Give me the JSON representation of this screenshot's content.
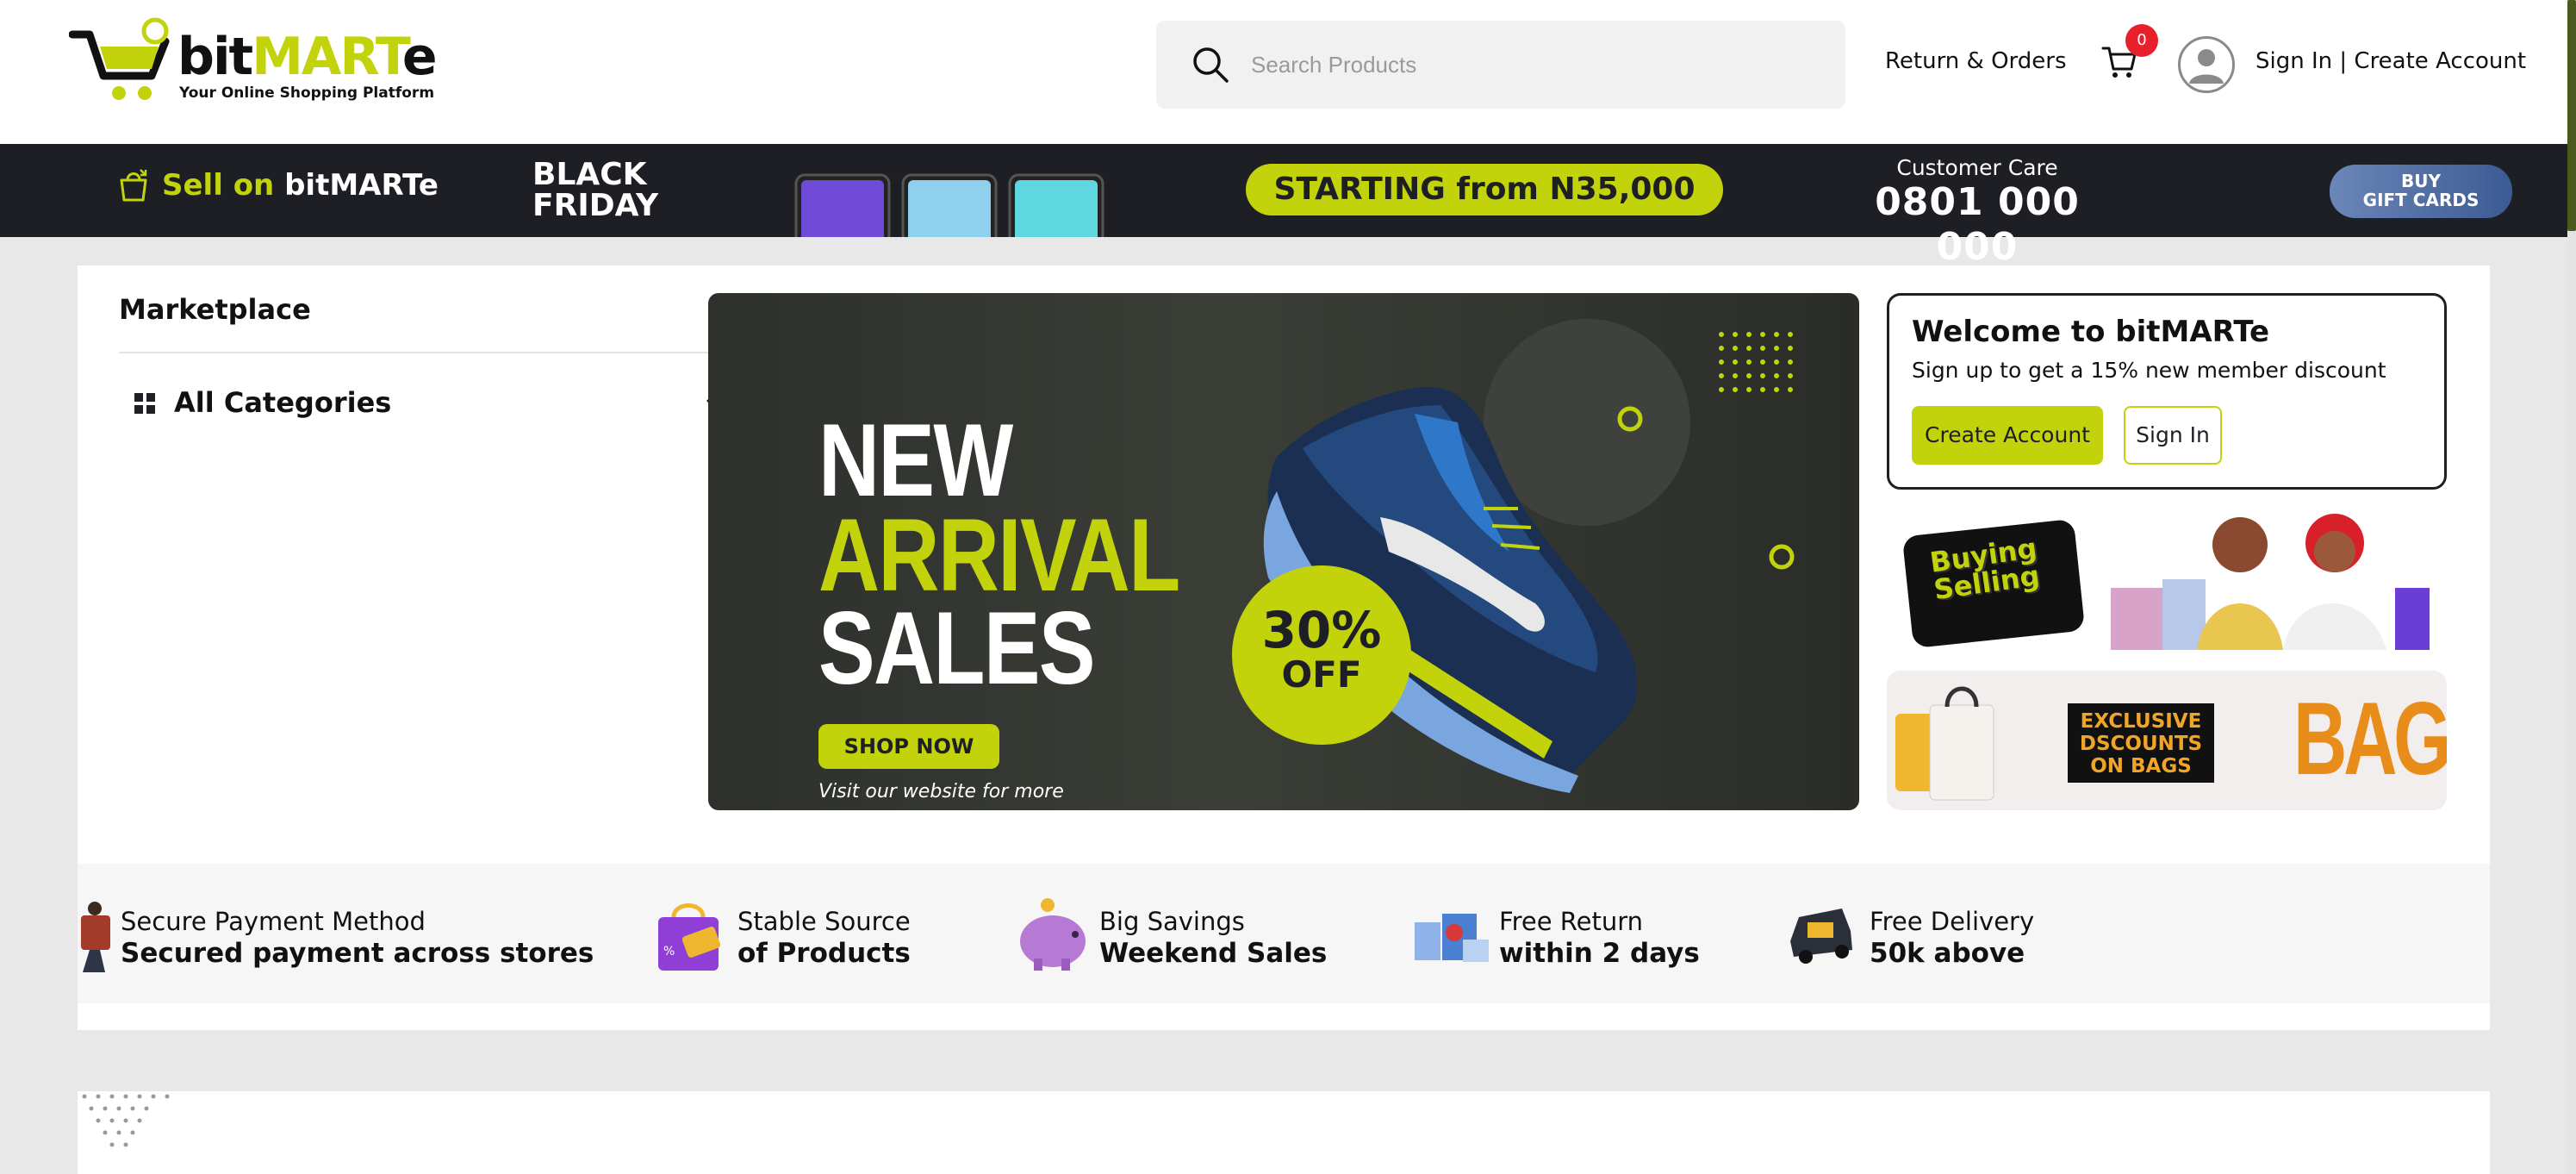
{
  "header": {
    "logo": {
      "name_part1": "bit",
      "name_part2": "MART",
      "name_part3": "e",
      "tagline": "Your Online Shopping Platform"
    },
    "search": {
      "placeholder": "Search Products",
      "value": ""
    },
    "return_orders": "Return & Orders",
    "cart_count": "0",
    "signin_label": "Sign In | Create Account"
  },
  "promo_strip": {
    "sell_prefix": "Sell on ",
    "sell_brand": "bitMARTe",
    "black_friday": [
      "BLACK",
      "FRIDAY"
    ],
    "starting": "STARTING from N35,000",
    "care_label": "Customer Care",
    "care_number": "0801 000 000",
    "gift_cards": [
      "BUY",
      "GIFT CARDS"
    ]
  },
  "marketplace": {
    "title": "Marketplace",
    "all_categories": "All Categories"
  },
  "hero": {
    "line1": "NEW",
    "line2": "ARRIVAL",
    "line3": "SALES",
    "discount_pct": "30%",
    "discount_word": "OFF",
    "cta": "SHOP NOW",
    "footer": "Visit our website for more"
  },
  "welcome": {
    "title": "Welcome to bitMARTe",
    "subtitle": "Sign up to get a 15% new member discount",
    "create_account": "Create Account",
    "sign_in": "Sign In"
  },
  "side_banners": {
    "buying_selling": [
      "Buying",
      "Selling"
    ],
    "exclusive": [
      "EXCLUSIVE",
      "DSCOUNTS",
      "ON BAGS"
    ],
    "bags": "BAGS"
  },
  "features": [
    {
      "icon": "secure-payment-icon",
      "line1": "Secure Payment Method",
      "line2": "Secured payment across stores"
    },
    {
      "icon": "stable-source-icon",
      "line1": "Stable Source",
      "line2": "of Products"
    },
    {
      "icon": "piggy-bank-icon",
      "line1": "Big Savings",
      "line2": "Weekend Sales"
    },
    {
      "icon": "free-return-icon",
      "line1": "Free Return",
      "line2": "within 2 days"
    },
    {
      "icon": "delivery-truck-icon",
      "line1": "Free Delivery",
      "line2": "50k above"
    }
  ],
  "colors": {
    "accent": "#c2d30b",
    "dark": "#1e1f24",
    "badge": "#e8202a",
    "page_bg": "#e8e8e8"
  }
}
